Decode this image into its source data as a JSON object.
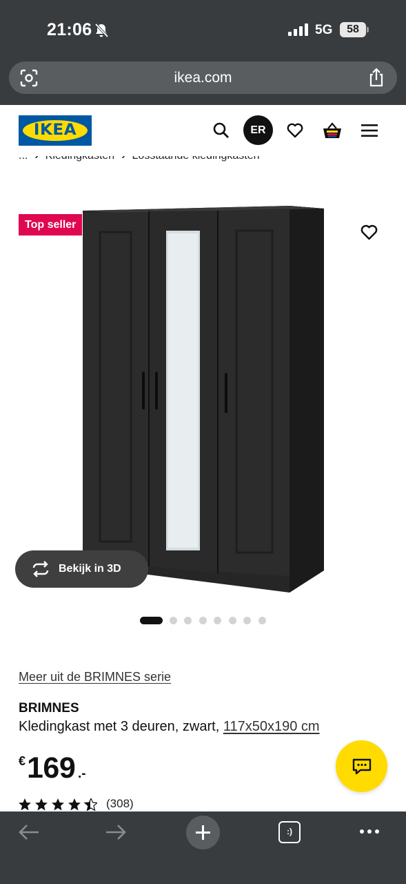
{
  "status_bar": {
    "time": "21:06",
    "network": "5G",
    "battery": "58"
  },
  "browser": {
    "url": "ikea.com",
    "icons": [
      "scan-icon",
      "share-icon"
    ]
  },
  "header": {
    "logo_text": "IKEA",
    "avatar_initials": "ER",
    "icons": [
      "search-icon",
      "heart-icon",
      "basket-icon",
      "menu-icon"
    ]
  },
  "breadcrumb": {
    "items": [
      "...",
      "Kledingkasten",
      "Losstaande kledingkasten"
    ]
  },
  "product": {
    "badge": "Top seller",
    "view_3d_label": "Bekijk in 3D",
    "carousel": {
      "total": 8,
      "active": 0
    },
    "series_link": "Meer uit de BRIMNES serie",
    "name": "BRIMNES",
    "description": "Kledingkast met 3 deuren, zwart,",
    "size": "117x50x190 cm",
    "price": {
      "currency": "€",
      "amount": "169",
      "decimals": ".-"
    },
    "rating": {
      "stars": 4.5,
      "max_stars": 5,
      "count": "(308)"
    }
  },
  "colors": {
    "ikea_blue": "#0058a3",
    "ikea_yellow": "#ffdb00",
    "top_seller_red": "#e00751",
    "browser_chrome": "#393c3f"
  },
  "toolbar": {
    "tabs_label": ":)",
    "icons": [
      "back-arrow-icon",
      "forward-arrow-icon",
      "plus-icon",
      "tabs-icon",
      "more-icon"
    ]
  }
}
